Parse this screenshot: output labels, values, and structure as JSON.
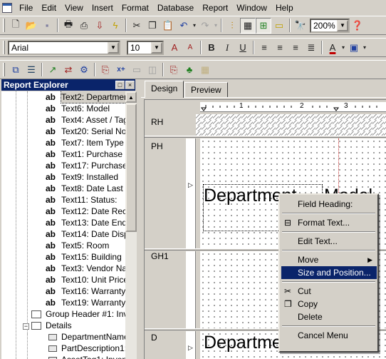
{
  "menu": [
    "File",
    "Edit",
    "View",
    "Insert",
    "Format",
    "Database",
    "Report",
    "Window",
    "Help"
  ],
  "toolbar": {
    "zoom": "200%"
  },
  "format": {
    "font": "Arial",
    "size": "10"
  },
  "explorer": {
    "title": "Report Explorer",
    "items": [
      {
        "label": "Text2: Departmen",
        "kind": "ab",
        "selected": true
      },
      {
        "label": "Text6: Model",
        "kind": "ab"
      },
      {
        "label": "Text4: Asset / Tag",
        "kind": "ab"
      },
      {
        "label": "Text20: Serial No",
        "kind": "ab"
      },
      {
        "label": "Text7: Item Type",
        "kind": "ab"
      },
      {
        "label": "Text1: Purchase D",
        "kind": "ab"
      },
      {
        "label": "Text17: Purchase",
        "kind": "ab"
      },
      {
        "label": "Text9: Installed",
        "kind": "ab"
      },
      {
        "label": "Text8: Date Last S",
        "kind": "ab"
      },
      {
        "label": "Text11: Status:",
        "kind": "ab"
      },
      {
        "label": "Text12: Date Rec",
        "kind": "ab"
      },
      {
        "label": "Text13: Date End",
        "kind": "ab"
      },
      {
        "label": "Text14: Date Disp",
        "kind": "ab"
      },
      {
        "label": "Text5: Room",
        "kind": "ab"
      },
      {
        "label": "Text15: Building",
        "kind": "ab"
      },
      {
        "label": "Text3: Vendor Nar",
        "kind": "ab"
      },
      {
        "label": "Text10: Unit Price",
        "kind": "ab"
      },
      {
        "label": "Text16: Warranty",
        "kind": "ab"
      },
      {
        "label": "Text19: Warranty",
        "kind": "ab"
      },
      {
        "label": "Group Header #1: Inve",
        "kind": "section"
      },
      {
        "label": "Details",
        "kind": "section"
      },
      {
        "label": "DepartmentName",
        "kind": "field"
      },
      {
        "label": "PartDescription1: I",
        "kind": "field"
      },
      {
        "label": "AssetTag1: Invent",
        "kind": "field"
      }
    ]
  },
  "design": {
    "tabs": [
      "Design",
      "Preview"
    ],
    "sections": [
      "RH",
      "PH",
      "GH1",
      "D"
    ],
    "ph_text1": "Department",
    "ph_text2": "Model",
    "d_text1": "Departme",
    "ruler_marks": [
      "1",
      "2",
      "3"
    ]
  },
  "context_menu": [
    {
      "label": "Field Heading:"
    },
    {
      "sep": true
    },
    {
      "label": "Format Text...",
      "icon": "format"
    },
    {
      "sep": true
    },
    {
      "label": "Edit Text..."
    },
    {
      "sep": true
    },
    {
      "label": "Move",
      "sub": true
    },
    {
      "label": "Size and Position...",
      "hi": true
    },
    {
      "sep": true
    },
    {
      "label": "Cut",
      "icon": "cut"
    },
    {
      "label": "Copy",
      "icon": "copy"
    },
    {
      "label": "Delete"
    },
    {
      "sep": true
    },
    {
      "label": "Cancel Menu"
    }
  ]
}
